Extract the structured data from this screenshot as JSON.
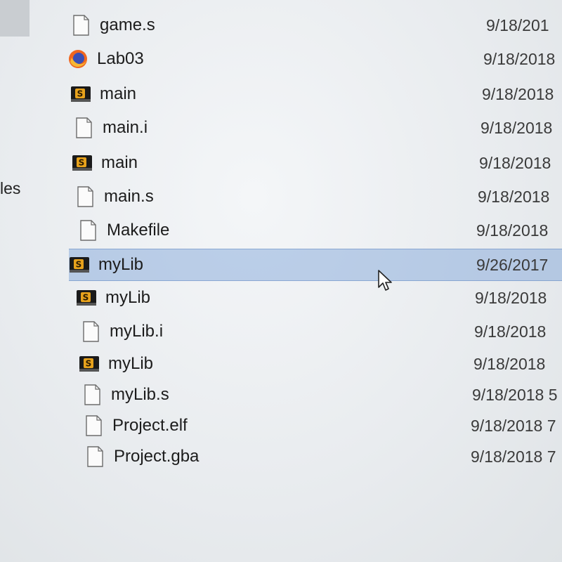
{
  "sidebar": {
    "partial_label": "les"
  },
  "files": [
    {
      "name": "game.s",
      "date": "9/18/201",
      "icon": "file-icon"
    },
    {
      "name": "Lab03",
      "date": "9/18/2018",
      "icon": "firefox-icon"
    },
    {
      "name": "main",
      "date": "9/18/2018",
      "icon": "assembly-file-icon"
    },
    {
      "name": "main.i",
      "date": "9/18/2018",
      "icon": "file-icon"
    },
    {
      "name": "main",
      "date": "9/18/2018",
      "icon": "assembly-file-icon"
    },
    {
      "name": "main.s",
      "date": "9/18/2018",
      "icon": "file-icon"
    },
    {
      "name": "Makefile",
      "date": "9/18/2018",
      "icon": "file-icon"
    },
    {
      "name": "myLib",
      "date": "9/26/2017",
      "icon": "assembly-file-icon",
      "selected": true
    },
    {
      "name": "myLib",
      "date": "9/18/2018",
      "icon": "assembly-file-icon"
    },
    {
      "name": "myLib.i",
      "date": "9/18/2018",
      "icon": "file-icon"
    },
    {
      "name": "myLib",
      "date": "9/18/2018",
      "icon": "assembly-file-icon"
    },
    {
      "name": "myLib.s",
      "date": "9/18/2018 5",
      "icon": "file-icon"
    },
    {
      "name": "Project.elf",
      "date": "9/18/2018 7",
      "icon": "file-icon"
    },
    {
      "name": "Project.gba",
      "date": "9/18/2018 7",
      "icon": "file-icon"
    }
  ],
  "colors": {
    "selection": "#7aa0d7",
    "assembly_icon_bg": "#1a1a1a",
    "assembly_icon_badge": "#e7a21c",
    "firefox_orange": "#f0661e",
    "firefox_blue": "#3a4fb4"
  }
}
